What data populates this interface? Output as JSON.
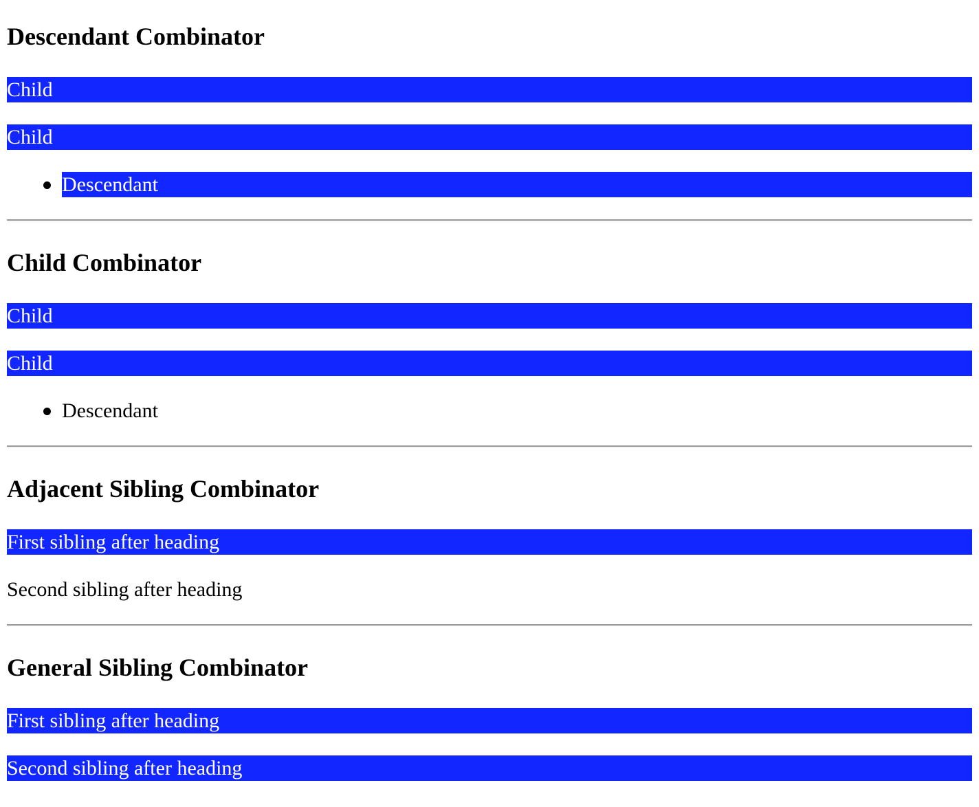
{
  "sections": [
    {
      "title": "Descendant Combinator",
      "rows": [
        "Child",
        "Child"
      ],
      "list_item": "Descendant"
    },
    {
      "title": "Child Combinator",
      "rows": [
        "Child",
        "Child"
      ],
      "list_item": "Descendant"
    },
    {
      "title": "Adjacent Sibling Combinator",
      "rows": [
        "First sibling after heading",
        "Second sibling after heading"
      ]
    },
    {
      "title": "General Sibling Combinator",
      "rows": [
        "First sibling after heading",
        "Second sibling after heading"
      ]
    }
  ],
  "colors": {
    "highlight_background": "#1226ff",
    "highlight_text": "#ffffff",
    "text": "#000000",
    "rule": "#9a9a9a"
  }
}
